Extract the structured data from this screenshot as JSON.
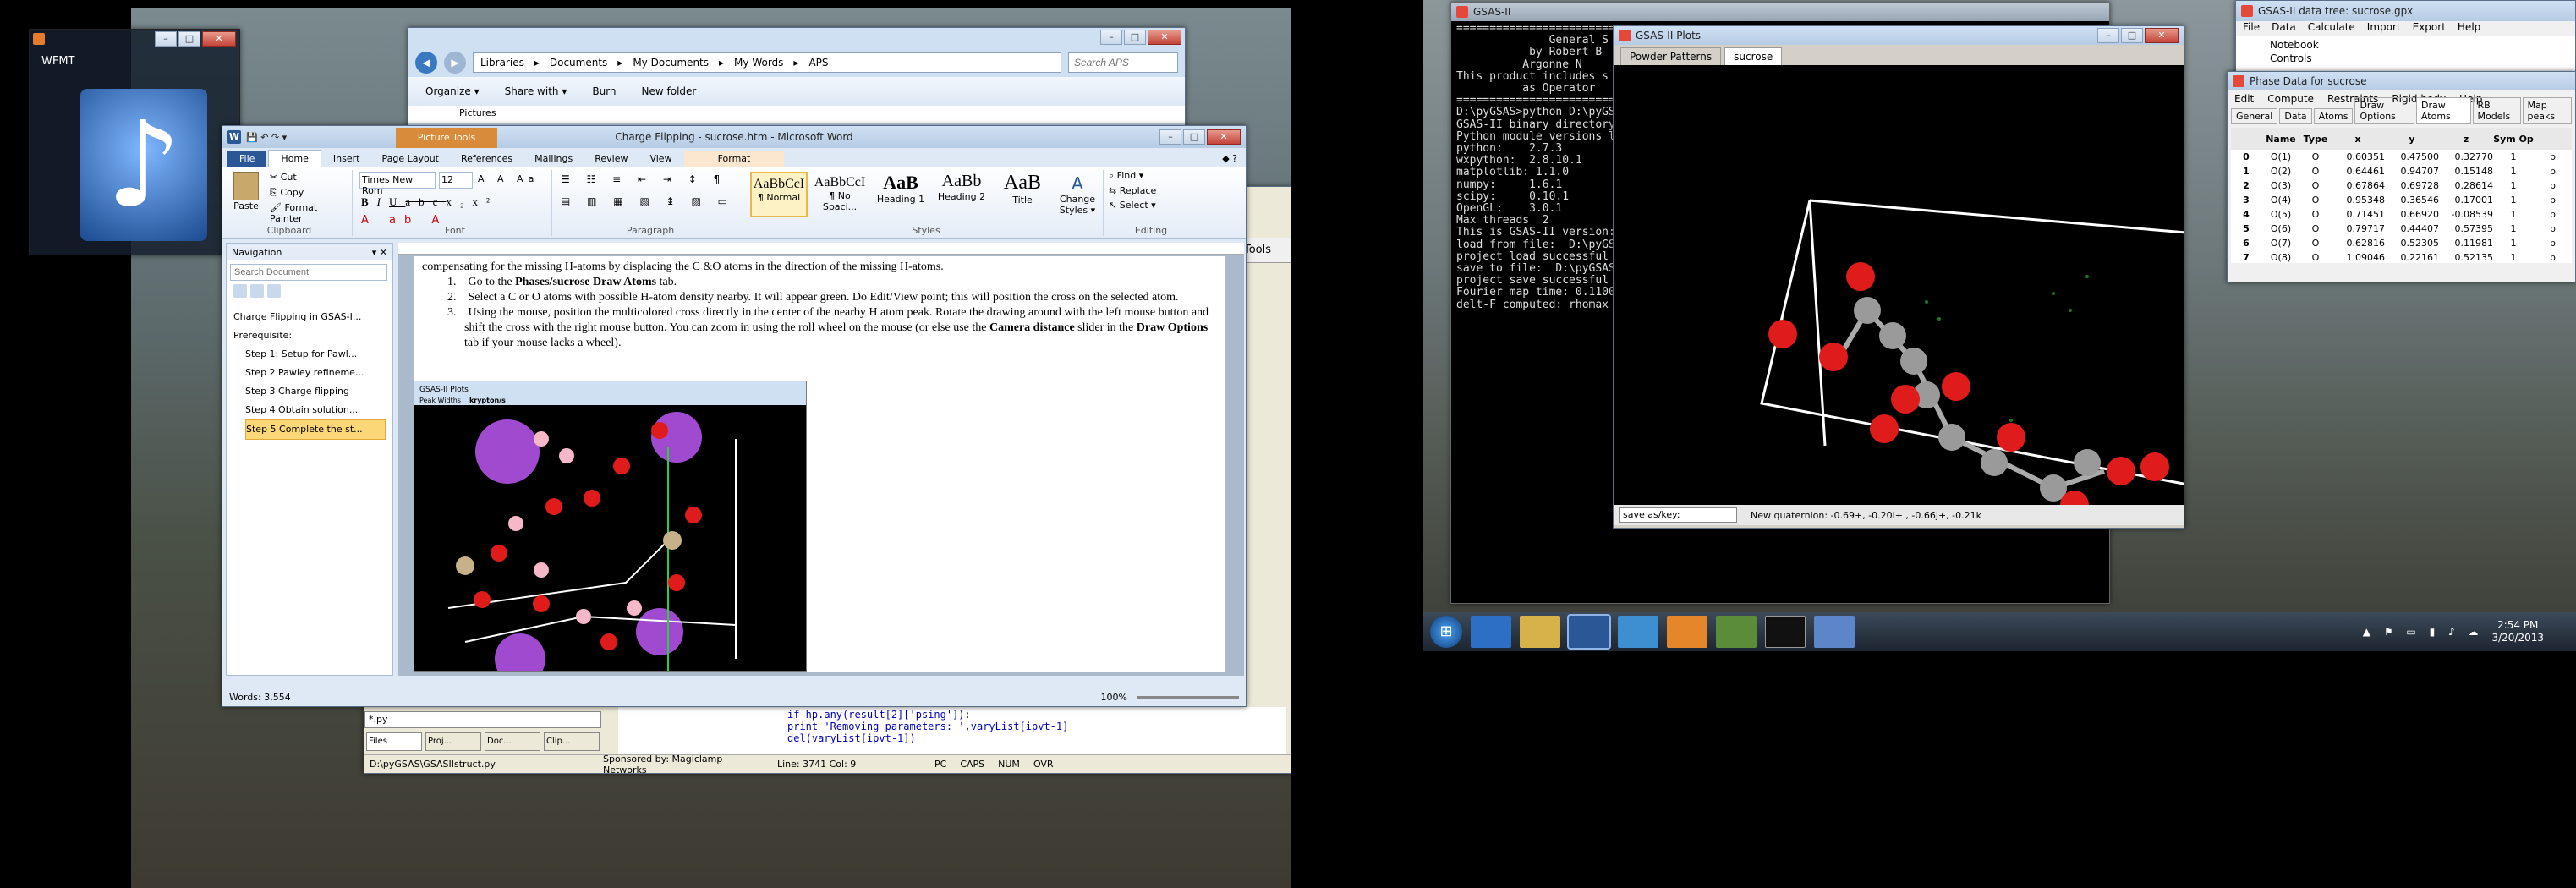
{
  "wfmt": {
    "title": "WFMT"
  },
  "explorer": {
    "crumbs": [
      "Libraries",
      "Documents",
      "My Documents",
      "My Words",
      "APS"
    ],
    "search_placeholder": "Search APS",
    "toolbar": [
      "Organize ▾",
      "Share with ▾",
      "Burn",
      "New folder"
    ],
    "row": "Pictures"
  },
  "word": {
    "title": "Charge Flipping - sucrose.htm - Microsoft Word",
    "context_tab": "Picture Tools",
    "tabs": [
      "File",
      "Home",
      "Insert",
      "Page Layout",
      "References",
      "Mailings",
      "Review",
      "View",
      "Format"
    ],
    "clipboard": {
      "paste": "Paste",
      "cut": "Cut",
      "copy": "Copy",
      "format_painter": "Format Painter",
      "group": "Clipboard"
    },
    "font": {
      "name": "Times New Rom",
      "size": "12",
      "group": "Font"
    },
    "paragraph": {
      "group": "Paragraph"
    },
    "styles": {
      "group": "Styles",
      "items": [
        {
          "sample": "AaBbCcI",
          "label": "¶ Normal"
        },
        {
          "sample": "AaBbCcI",
          "label": "¶ No Spaci..."
        },
        {
          "sample": "AaB",
          "label": "Heading 1"
        },
        {
          "sample": "AaBb",
          "label": "Heading 2"
        },
        {
          "sample": "AaB",
          "label": "Title"
        }
      ],
      "change": "Change Styles ▾"
    },
    "editing": {
      "group": "Editing",
      "find": "Find ▾",
      "replace": "Replace",
      "select": "Select ▾"
    },
    "nav": {
      "title": "Navigation",
      "search_placeholder": "Search Document",
      "items": [
        "Charge Flipping in GSAS-I...",
        "Prerequisite:",
        "Step 1: Setup for Pawl...",
        "Step 2 Pawley refineme...",
        "Step 3 Charge flipping",
        "Step 4 Obtain solution...",
        "Step 5 Complete the st..."
      ]
    },
    "doc": {
      "intro": "compensating for the missing H-atoms by displacing the C &O atoms in the direction of the missing H-atoms.",
      "l1_pre": "Go to the ",
      "l1_b": "Phases/sucrose Draw Atoms",
      "l1_post": " tab.",
      "l2": "Select a C or O atoms with possible H-atom density nearby. It will appear green. Do Edit/View point; this will position the cross on the selected atom.",
      "l3_a": "Using the mouse, position the multicolored cross directly in the center of the nearby H atom peak. Rotate the drawing around with the left mouse button and shift the cross with the right mouse button. You can zoom in using the roll wheel on the mouse (or else use the ",
      "l3_b": "Camera distance",
      "l3_c": " slider in the ",
      "l3_d": "Draw Options",
      "l3_e": " tab if your mouse lacks a wheel).",
      "img_title": "GSAS-II Plots",
      "img_tabs": [
        "Peak Widths",
        "krypton/s"
      ]
    },
    "status": {
      "words": "Words: 3,554",
      "zoom": "100%"
    }
  },
  "editor": {
    "file_tabs": [
      "Files",
      "Proj...",
      "Doc...",
      "Clip..."
    ],
    "path": "D:\\pyGSAS\\GSASIIstruct.py",
    "sponsor": "Sponsored by: Magiclamp Networks",
    "pos": "Line: 3741 Col: 9",
    "modes": [
      "PC",
      "CAPS",
      "NUM",
      "OVR"
    ],
    "combo": "*.py",
    "tools": "Tools",
    "code": [
      "if hp.any(result[2]['psing']):",
      "    print 'Removing parameters: ',varyList[ipvt-1]",
      "    del(varyList[ipvt-1])"
    ]
  },
  "console": {
    "title": "GSAS-II",
    "lines": [
      "========================================",
      "              General S",
      "           by Robert B",
      "          Argonne N",
      "This product includes s",
      "          as Operator",
      "========================================",
      "",
      "D:\\pyGSAS>python D:\\pyGS",
      "GSAS-II binary directory",
      "Python module versions l",
      "python:    2.7.3",
      "wxpython:  2.8.10.1",
      "matplotlib: 1.1.0",
      "numpy:     1.6.1",
      "scipy:     0.10.1",
      "OpenGL:    3.0.1",
      "Max threads  2",
      "This is GSAS-II version:",
      "load from file:  D:\\pyGS",
      "project load successful",
      "save to file:  D:\\pyGSAS",
      "project save successful",
      "Fourier map time: 0.1100",
      "delt-F computed: rhomax"
    ]
  },
  "plots": {
    "title": "GSAS-II Plots",
    "tabs": [
      "Powder Patterns",
      "sucrose"
    ],
    "combo": "save as/key:",
    "quaternion": "New quaternion: -0.69+, -0.20i+ , -0.66j+, -0.21k"
  },
  "datatree": {
    "title": "GSAS-II data tree: sucrose.gpx",
    "menu": [
      "File",
      "Data",
      "Calculate",
      "Import",
      "Export",
      "Help"
    ],
    "items": [
      "Notebook",
      "Controls"
    ]
  },
  "phase": {
    "title": "Phase Data for sucrose",
    "menu": [
      "Edit",
      "Compute",
      "Restraints",
      "Rigid body",
      "Help"
    ],
    "tabs": [
      "General",
      "Data",
      "Atoms",
      "Draw Options",
      "Draw Atoms",
      "RB Models",
      "Map peaks"
    ],
    "headers": [
      "",
      "Name",
      "Type",
      "x",
      "y",
      "z",
      "Sym Op",
      ""
    ],
    "rows": [
      [
        "0",
        "O(1)",
        "O",
        "0.60351",
        "0.47500",
        "0.32770",
        "1",
        "b"
      ],
      [
        "1",
        "O(2)",
        "O",
        "0.64461",
        "0.94707",
        "0.15148",
        "1",
        "b"
      ],
      [
        "2",
        "O(3)",
        "O",
        "0.67864",
        "0.69728",
        "0.28614",
        "1",
        "b"
      ],
      [
        "3",
        "O(4)",
        "O",
        "0.95348",
        "0.36546",
        "0.17001",
        "1",
        "b"
      ],
      [
        "4",
        "O(5)",
        "O",
        "0.71451",
        "0.66920",
        "-0.08539",
        "1",
        "b"
      ],
      [
        "5",
        "O(6)",
        "O",
        "0.79717",
        "0.44407",
        "0.57395",
        "1",
        "b"
      ],
      [
        "6",
        "O(7)",
        "O",
        "0.62816",
        "0.52305",
        "0.11981",
        "1",
        "b"
      ],
      [
        "7",
        "O(8)",
        "O",
        "1.09046",
        "0.22161",
        "0.52135",
        "1",
        "b"
      ]
    ]
  },
  "taskbar": {
    "time": "2:54 PM",
    "date": "3/20/2013"
  }
}
